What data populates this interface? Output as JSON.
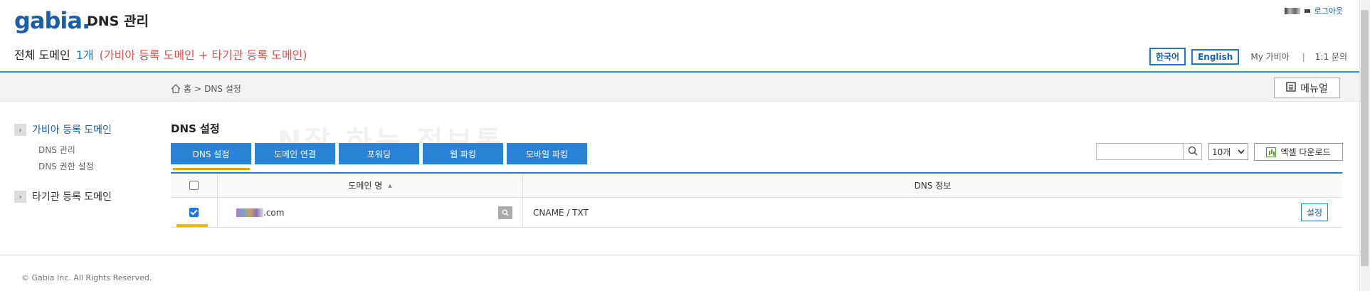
{
  "header": {
    "logo": "gabia.",
    "app_title": "DNS 관리",
    "logout": "로그아웃"
  },
  "summary": {
    "label": "전체 도메인",
    "count": "1개",
    "description": "(가비아 등록 도메인 + 타기관 등록 도메인)"
  },
  "topnav": {
    "korean": "한국어",
    "english": "English",
    "my_gabia": "My 가비아",
    "separator": "|",
    "support": "1:1 문의"
  },
  "breadcrumb": {
    "home": "홈",
    "sep": ">",
    "current": "DNS 설정"
  },
  "manual_button": "메뉴얼",
  "sidebar": {
    "items": [
      {
        "label": "가비아 등록 도메인",
        "active": true
      },
      {
        "label": "DNS 관리"
      },
      {
        "label": "DNS 권한 설정"
      },
      {
        "label": "타기관 등록 도메인"
      }
    ]
  },
  "main": {
    "section_title": "DNS 설정",
    "tabs": [
      {
        "label": "DNS 설정",
        "active": true
      },
      {
        "label": "도메인 연결"
      },
      {
        "label": "포워딩"
      },
      {
        "label": "웹 파킹"
      },
      {
        "label": "모바일 파킹"
      }
    ],
    "search_value": "",
    "per_page": "10개",
    "excel_button": "엑셀 다운로드"
  },
  "table": {
    "columns": [
      "도메인 명",
      "DNS 정보"
    ],
    "sort_indicator": "▲",
    "rows": [
      {
        "checked": true,
        "domain_suffix": ".com",
        "dns_info": "CNAME / TXT",
        "action": "설정"
      }
    ]
  },
  "footer": {
    "copyright": "© Gabia Inc. All Rights Reserved."
  },
  "colors": {
    "brand_blue": "#2a82d6",
    "accent_yellow": "#e6a700",
    "description_red": "#d9534f"
  }
}
